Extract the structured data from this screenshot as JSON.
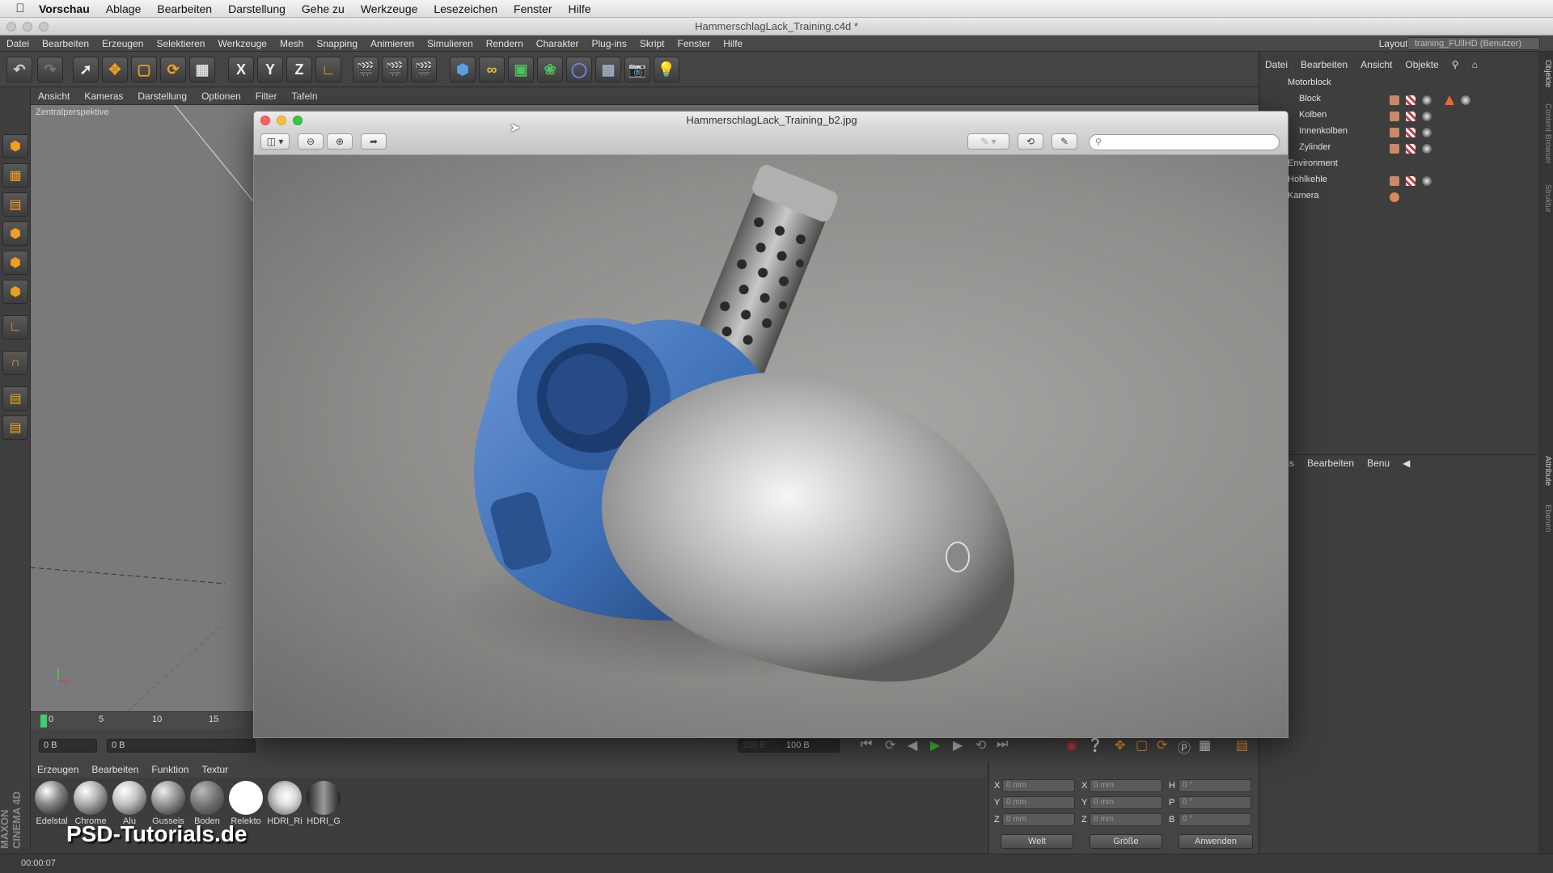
{
  "macmenu": [
    "Vorschau",
    "Ablage",
    "Bearbeiten",
    "Darstellung",
    "Gehe zu",
    "Werkzeuge",
    "Lesezeichen",
    "Fenster",
    "Hilfe"
  ],
  "window_title": "HammerschlagLack_Training.c4d *",
  "c4dmenu": [
    "Datei",
    "Bearbeiten",
    "Erzeugen",
    "Selektieren",
    "Werkzeuge",
    "Mesh",
    "Snapping",
    "Animieren",
    "Simulieren",
    "Rendern",
    "Charakter",
    "Plug-ins",
    "Skript",
    "Fenster",
    "Hilfe"
  ],
  "layout": {
    "label": "Layout:",
    "value": "training_FUllHD (Benutzer)"
  },
  "toolbar": {
    "x_label": "X",
    "y_label": "Y",
    "z_label": "Z"
  },
  "viewport": {
    "menu": [
      "Ansicht",
      "Kameras",
      "Darstellung",
      "Optionen",
      "Filter",
      "Tafeln"
    ],
    "label": "Zentralperspektive"
  },
  "timeline": {
    "ticks": [
      "0",
      "5",
      "10",
      "15"
    ],
    "start_field": "0 B",
    "current_field": "0 B",
    "end_field_a": "100 B",
    "end_field_b": "100 B"
  },
  "material_manager": {
    "menu": [
      "Erzeugen",
      "Bearbeiten",
      "Funktion",
      "Textur"
    ],
    "materials": [
      {
        "name": "Edelstal",
        "color": "#8a8a8a"
      },
      {
        "name": "Chrome",
        "color": "#b0b0b0"
      },
      {
        "name": "Alu",
        "color": "#c4c4c4"
      },
      {
        "name": "Gusseis",
        "color": "#9a9a9a"
      },
      {
        "name": "Boden",
        "color": "#6e6e6e"
      },
      {
        "name": "Relekto",
        "color": "#ffffff"
      },
      {
        "name": "HDRI_Ri",
        "color": "#d8d8d8"
      },
      {
        "name": "HDRI_G",
        "color": "#555555"
      }
    ]
  },
  "coords": {
    "rows": [
      {
        "a": "X",
        "av": "0 mm",
        "b": "X",
        "bv": "0 mm",
        "c": "H",
        "cv": "0 °"
      },
      {
        "a": "Y",
        "av": "0 mm",
        "b": "Y",
        "bv": "0 mm",
        "c": "P",
        "cv": "0 °"
      },
      {
        "a": "Z",
        "av": "0 mm",
        "b": "Z",
        "bv": "0 mm",
        "c": "B",
        "cv": "0 °"
      }
    ],
    "mode_world": "Welt",
    "mode_size": "Größe",
    "apply": "Anwenden"
  },
  "status_time": "00:00:07",
  "object_manager": {
    "menu": [
      "Datei",
      "Bearbeiten",
      "Ansicht",
      "Objekte"
    ],
    "objects": [
      "Motorblock",
      "Block",
      "Kolben",
      "Innenkolben",
      "Zylinder",
      "Environment",
      "Hohlkehle",
      "Kamera"
    ]
  },
  "attribute_manager": {
    "menu": [
      "Modus",
      "Bearbeiten",
      "Benu"
    ]
  },
  "side_tabs": [
    "Objekte",
    "Content Browser",
    "Struktur",
    "Attribute",
    "Ebenen"
  ],
  "preview": {
    "title": "HammerschlagLack_Training_b2.jpg",
    "search_placeholder": ""
  },
  "watermark": "PSD-Tutorials.de",
  "maxon": "MAXON CINEMA 4D"
}
